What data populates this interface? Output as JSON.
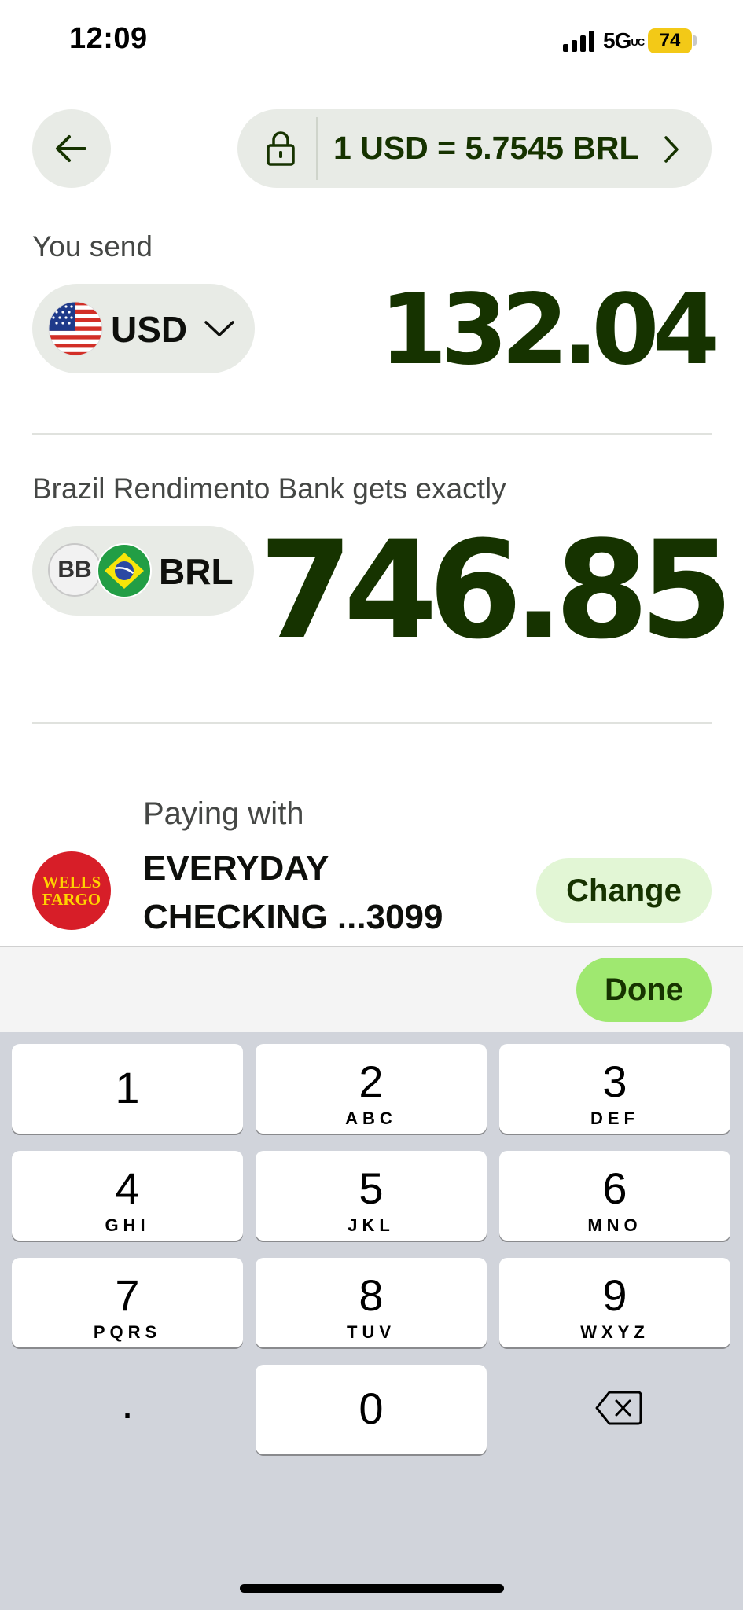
{
  "status_bar": {
    "time": "12:09",
    "network": "5G",
    "network_suffix": "UC",
    "battery": "74"
  },
  "header": {
    "back_icon": "arrow-left-icon",
    "lock_icon": "lock-icon",
    "rate_text": "1 USD = 5.7545 BRL",
    "chevron_icon": "chevron-right-icon"
  },
  "send": {
    "label": "You send",
    "currency": "USD",
    "flag_icon": "us-flag-icon",
    "amount": "132.04"
  },
  "receive": {
    "label": "Brazil Rendimento Bank gets exactly",
    "bank_badge": "BB",
    "flag_icon": "brazil-flag-icon",
    "currency": "BRL",
    "amount": "746.85"
  },
  "payment": {
    "label": "Paying with",
    "logo_line1": "WELLS",
    "logo_line2": "FARGO",
    "account": "EVERYDAY CHECKING ...3099",
    "change_label": "Change"
  },
  "keyboard": {
    "done_label": "Done",
    "keys": [
      {
        "num": "1",
        "letters": ""
      },
      {
        "num": "2",
        "letters": "ABC"
      },
      {
        "num": "3",
        "letters": "DEF"
      },
      {
        "num": "4",
        "letters": "GHI"
      },
      {
        "num": "5",
        "letters": "JKL"
      },
      {
        "num": "6",
        "letters": "MNO"
      },
      {
        "num": "7",
        "letters": "PQRS"
      },
      {
        "num": "8",
        "letters": "TUV"
      },
      {
        "num": "9",
        "letters": "WXYZ"
      },
      {
        "num": "0",
        "letters": ""
      }
    ],
    "decimal": ".",
    "delete_icon": "backspace-icon"
  },
  "colors": {
    "brand_dark": "#163300",
    "brand_green": "#9fe870",
    "pill_bg": "#e8ebe6",
    "change_bg": "#e2f6d5",
    "wells_red": "#d71e28",
    "keyboard_bg": "#d1d4db"
  }
}
